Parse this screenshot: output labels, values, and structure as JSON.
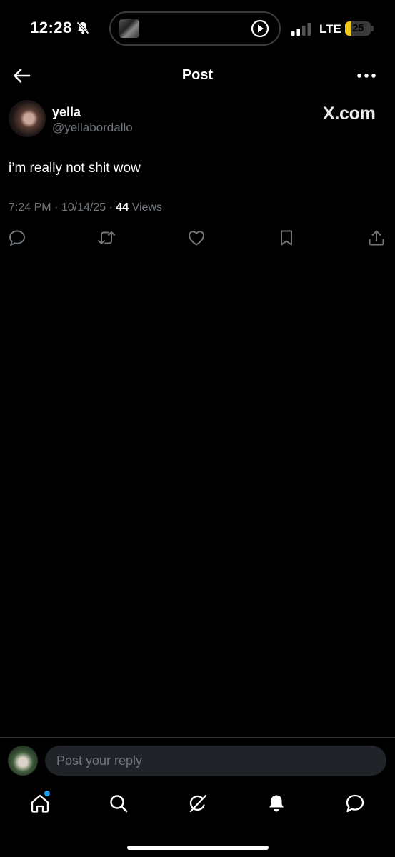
{
  "status_bar": {
    "time": "12:28",
    "network": "LTE",
    "battery_level": "25",
    "battery_color": "#f5c518"
  },
  "header": {
    "title": "Post",
    "back_icon": "arrow-left-icon",
    "more_icon": "more-horizontal-icon"
  },
  "post": {
    "author_name": "yella",
    "author_handle": "@yellabordallo",
    "source_label": "X.com",
    "text": "i’m really not shit wow",
    "time": "7:24 PM",
    "date": "10/14/25",
    "separator": "·",
    "views_count": "44",
    "views_label": "Views"
  },
  "actions": [
    "reply-icon",
    "repost-icon",
    "like-icon",
    "bookmark-icon",
    "share-icon"
  ],
  "reply": {
    "placeholder": "Post your reply"
  },
  "bottom_nav": [
    "home-icon",
    "search-icon",
    "grok-icon",
    "notifications-icon",
    "messages-icon"
  ],
  "colors": {
    "background": "#000000",
    "text_primary": "#e7e9ea",
    "text_secondary": "#71767b",
    "accent": "#1d9bf0"
  }
}
